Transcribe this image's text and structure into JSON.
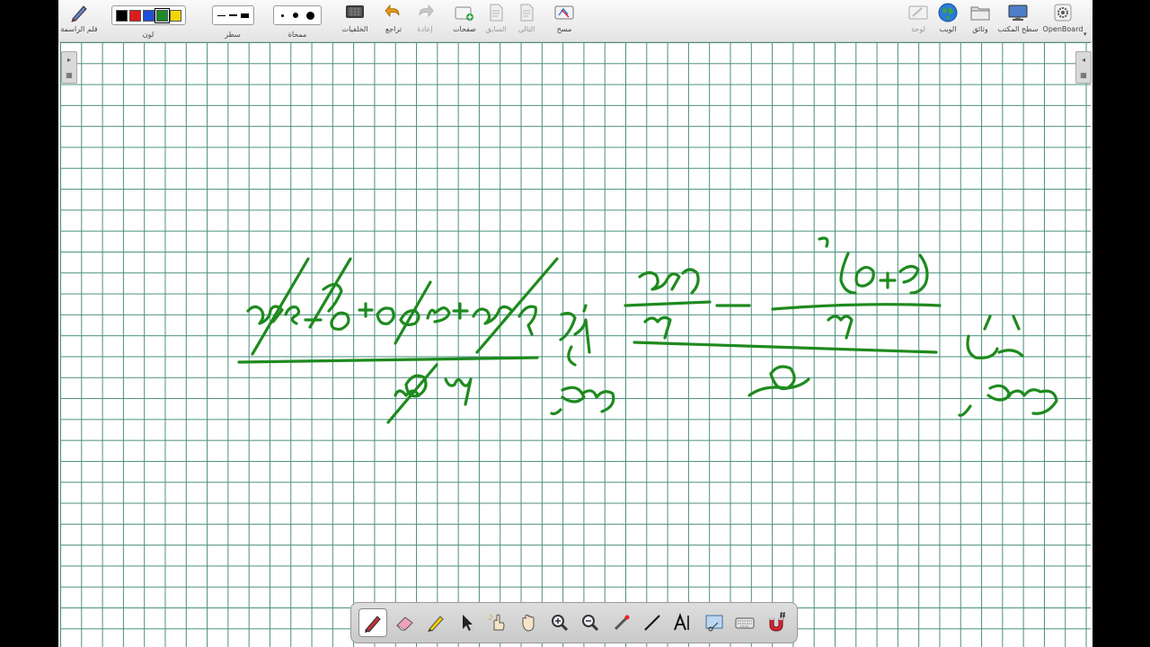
{
  "toolbar": {
    "left": {
      "pen_label": "قلم الراسمة",
      "color_label": "لون",
      "line_label": "سطر",
      "eraser_label": "ممحاة",
      "backgrounds_label": "الخلفيات",
      "undo_label": "تراجع",
      "redo_label": "إعادة",
      "pages_label": "صفحات",
      "previous_label": "السابق",
      "next_label": "التالي",
      "clear_label": "مسح",
      "colors": [
        "#000000",
        "#e01b1b",
        "#1f4fd8",
        "#1d8a2c",
        "#f2d500"
      ],
      "selected_color": "#1d8a2c"
    },
    "right": {
      "board_label": "لوحة",
      "web_label": "الويب",
      "documents_label": "وثائق",
      "desktop_label": "سطح المكتب",
      "openboard_label": "OpenBoard"
    }
  },
  "board": {
    "background": "grid",
    "grid_color": "#4a8f7f",
    "ink_color": "#1e8a1e"
  },
  "stylus_palette": {
    "tools": [
      "pen-icon",
      "eraser-icon",
      "highlighter-icon",
      "selector-icon",
      "interact-icon",
      "hand-icon",
      "zoom-in-icon",
      "zoom-out-icon",
      "laser-pointer-icon",
      "line-icon",
      "text-icon",
      "capture-icon",
      "keyboard-icon",
      "magnet-icon"
    ],
    "active_tool": "pen-icon"
  }
}
